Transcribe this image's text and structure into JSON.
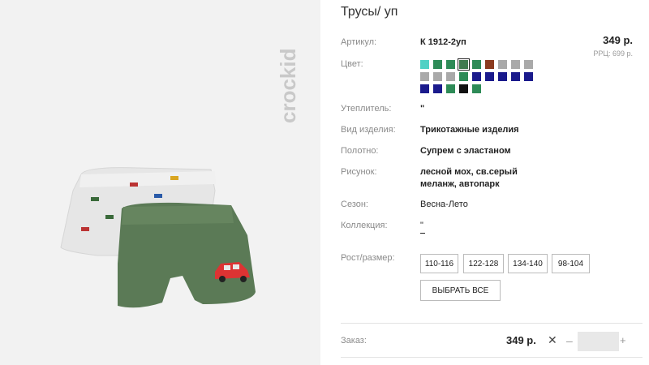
{
  "product": {
    "title": "Трусы/ уп",
    "article_label": "Артикул:",
    "article_value": "К 1912-2уп",
    "price": "349 р.",
    "rrp": "РРЦ: 699 р.",
    "color_label": "Цвет:",
    "swatches": [
      {
        "color": "#4fd1c5"
      },
      {
        "color": "#2e8b57"
      },
      {
        "color": "#2e8b57"
      },
      {
        "color": "#3f7a4f",
        "selected": true
      },
      {
        "color": "#2e8b57"
      },
      {
        "color": "#8b3a1e"
      },
      {
        "color": "#a9a9a9"
      },
      {
        "color": "#a9a9a9"
      },
      {
        "color": "#a9a9a9"
      },
      {
        "color": "#a9a9a9"
      },
      {
        "color": "#a9a9a9"
      },
      {
        "color": "#a9a9a9"
      },
      {
        "color": "#2e8b57"
      },
      {
        "color": "#1a1a8c"
      },
      {
        "color": "#1a1a8c"
      },
      {
        "color": "#1a1a8c"
      },
      {
        "color": "#1a1a8c"
      },
      {
        "color": "#1a1a8c"
      },
      {
        "color": "#1a1a8c"
      },
      {
        "color": "#1a1a8c"
      },
      {
        "color": "#2e8b57"
      },
      {
        "color": "#111111"
      },
      {
        "color": "#2e8b57"
      }
    ],
    "insulation_label": "Утеплитель:",
    "insulation_value": "\"",
    "type_label": "Вид изделия:",
    "type_value": "Трикотажные изделия",
    "fabric_label": "Полотно:",
    "fabric_value": "Супрем с эластаном",
    "pattern_label": "Рисунок:",
    "pattern_line1": "лесной мох, св.серый",
    "pattern_line2": "меланж, автопарк",
    "season_label": "Сезон:",
    "season_value": "Весна-Лето",
    "collection_label": "Коллекция:",
    "collection_value": "\"",
    "size_label": "Рост/размер:",
    "sizes": [
      "110-116",
      "122-128",
      "134-140",
      "98-104"
    ],
    "select_all": "ВЫБРАТЬ ВСЕ",
    "order_label": "Заказ:",
    "order_price": "349 р.",
    "remove_icon": "close-icon",
    "minus": "–",
    "plus": "+"
  },
  "brand": {
    "logo_text": "crockid"
  }
}
